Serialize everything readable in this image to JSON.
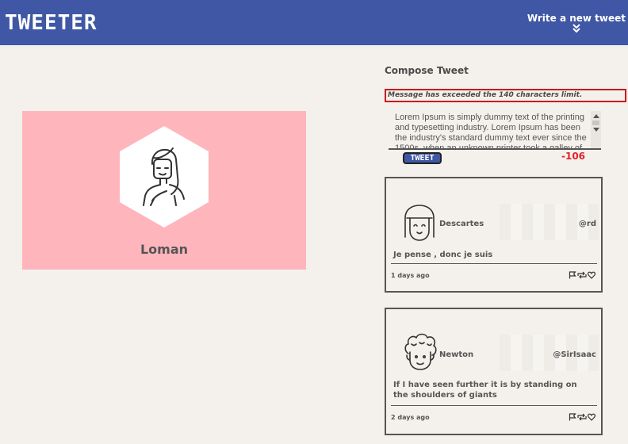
{
  "header": {
    "logo": "TWEETER",
    "write_new": "Write a new tweet",
    "write_new_icon": "double-chevron-down-icon"
  },
  "profile": {
    "name": "Loman",
    "background_color": "#feb5bc",
    "avatar_icon": "woman-avatar-icon"
  },
  "compose": {
    "title": "Compose Tweet",
    "error": "Message has exceeded the 140 characters limit.",
    "text": "Lorem Ipsum is simply dummy text of the printing and typesetting industry. Lorem Ipsum has been the industry's standard dummy text ever since the 1500s, when an unknown printer took a galley of type and scrambled it to make a type specimen book.",
    "button_label": "TWEET",
    "counter": "-106"
  },
  "tweets": [
    {
      "user": "Descartes",
      "handle": "@rd",
      "text": "Je pense , donc je suis",
      "time": "1 days ago",
      "avatar_icon": "girl-avatar-icon"
    },
    {
      "user": "Newton",
      "handle": "@SirIsaac",
      "text": "If I have seen further it is by standing on the shoulders of giants",
      "time": "2 days ago",
      "avatar_icon": "curly-hair-avatar-icon"
    }
  ],
  "action_icons": [
    "flag-icon",
    "retweet-icon",
    "heart-icon"
  ],
  "colors": {
    "header": "#3f57a4",
    "background": "#f4f1ec",
    "error_border": "#c81c1c",
    "counter": "#e0242a"
  }
}
